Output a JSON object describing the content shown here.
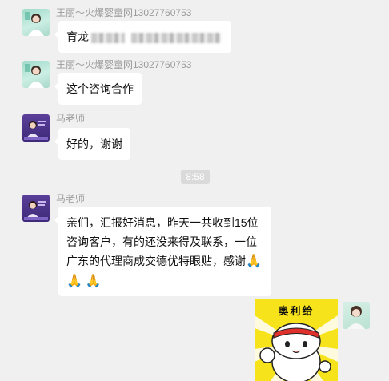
{
  "messages": [
    {
      "sender": "王丽～火爆婴童网13027760753",
      "text": "育龙"
    },
    {
      "sender": "王丽～火爆婴童网13027760753",
      "text": "这个咨询合作"
    },
    {
      "sender": "马老师",
      "text": "好的，谢谢"
    },
    {
      "sender": "马老师",
      "lines": [
        "亲们，汇报好消息，昨天一共收到15位",
        "咨询客户，有的还没来得及联系，一位",
        "广东的代理商成交德优特眼贴，感谢"
      ],
      "emoji": [
        "🙏",
        "🙏",
        "🙏"
      ]
    }
  ],
  "timestamp": "8:58",
  "sticker": {
    "text": "奥利给",
    "icon": "cartoon-cat-sticker"
  },
  "colors": {
    "background": "#f0f0f0",
    "bubble": "#ffffff",
    "time_badge": "#dadada",
    "sticker_bg": "#f7e31c"
  }
}
